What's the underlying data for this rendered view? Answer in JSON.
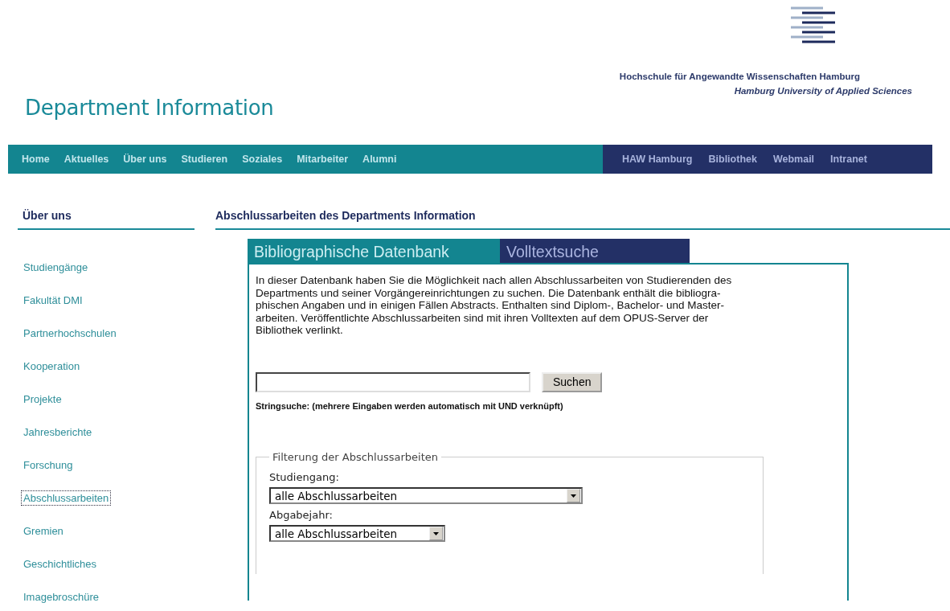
{
  "header": {
    "title": "Department Information",
    "university": "Hochschule für Angewandte Wissenschaften Hamburg",
    "university_en": "Hamburg University of Applied Sciences"
  },
  "nav": {
    "main": [
      "Home",
      "Aktuelles",
      "Über uns",
      "Studieren",
      "Soziales",
      "Mitarbeiter",
      "Alumni"
    ],
    "external": [
      "HAW Hamburg",
      "Bibliothek",
      "Webmail",
      "Intranet"
    ]
  },
  "sidebar": {
    "heading": "Über uns",
    "items": [
      {
        "label": "Studiengänge",
        "selected": false
      },
      {
        "label": "Fakultät DMI",
        "selected": false
      },
      {
        "label": "Partnerhochschulen",
        "selected": false
      },
      {
        "label": "Kooperation",
        "selected": false
      },
      {
        "label": "Projekte",
        "selected": false
      },
      {
        "label": "Jahresberichte",
        "selected": false
      },
      {
        "label": "Forschung",
        "selected": false
      },
      {
        "label": "Abschlussarbeiten",
        "selected": true
      },
      {
        "label": "Gremien",
        "selected": false
      },
      {
        "label": "Geschichtliches",
        "selected": false
      },
      {
        "label": "Imagebroschüre",
        "selected": false
      }
    ]
  },
  "main": {
    "heading": "Abschlussarbeiten des Departments Information",
    "tabs": [
      {
        "label": "Bibliographische Datenbank",
        "selected": true
      },
      {
        "label": "Volltextsuche",
        "selected": false
      }
    ],
    "intro": [
      "In dieser Datenbank haben Sie die Möglichkeit nach allen Abschlussarbeiten von Studierenden des",
      "Departments und seiner Vorgängereinrichtungen zu suchen. Die Datenbank enthält die bibliogra-",
      "phischen Angaben und in einigen Fällen Abstracts. Enthalten sind Diplom-, Bachelor- und Master-",
      "arbeiten. Veröffentlichte Abschlussarbeiten sind mit ihren Volltexten auf dem OPUS-Server der",
      "Bibliothek verlinkt."
    ],
    "search_button": "Suchen",
    "search_hint": "Stringsuche: (mehrere Eingaben werden automatisch mit UND verknüpft)",
    "filter": {
      "legend": "Filterung der Abschlussarbeiten",
      "fields": [
        {
          "label": "Studiengang:",
          "value": "alle Abschlussarbeiten",
          "kind": "wide"
        },
        {
          "label": "Abgabejahr:",
          "value": "alle Abschlussarbeiten",
          "kind": "narrow"
        }
      ]
    }
  }
}
